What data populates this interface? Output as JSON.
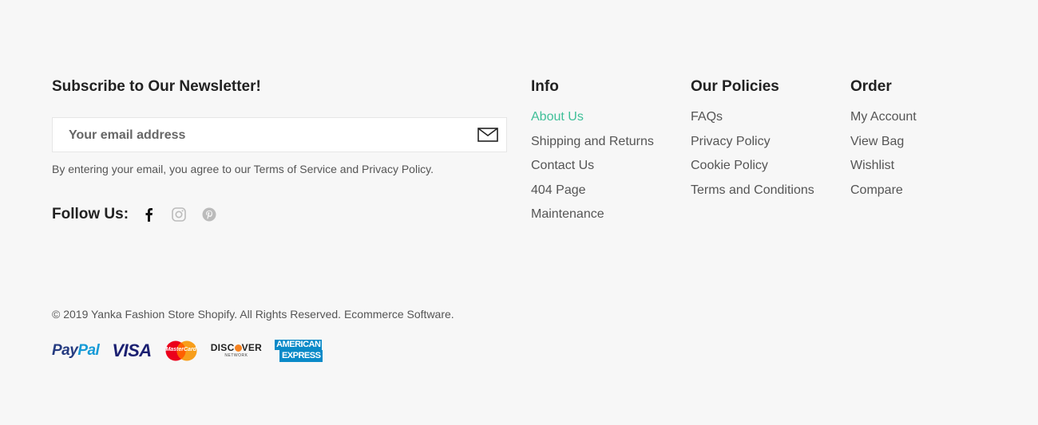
{
  "newsletter": {
    "title": "Subscribe to Our Newsletter!",
    "placeholder": "Your email address",
    "consent": "By entering your email, you agree to our Terms of Service and Privacy Policy."
  },
  "social": {
    "label": "Follow Us:",
    "icons": [
      "facebook-icon",
      "instagram-icon",
      "pinterest-icon"
    ]
  },
  "columns": [
    {
      "title": "Info",
      "links": [
        "About Us",
        "Shipping and Returns",
        "Contact Us",
        "404 Page",
        "Maintenance"
      ]
    },
    {
      "title": "Our Policies",
      "links": [
        "FAQs",
        "Privacy Policy",
        "Cookie Policy",
        "Terms and Conditions"
      ]
    },
    {
      "title": "Order",
      "links": [
        "My Account",
        "View Bag",
        "Wishlist",
        "Compare"
      ]
    }
  ],
  "copyright": "© 2019 Yanka Fashion Store Shopify. All Rights Reserved. Ecommerce Software.",
  "payments": {
    "paypal_a": "Pay",
    "paypal_b": "Pal",
    "visa": "VISA",
    "mastercard": "MasterCard",
    "discover": "DISC",
    "discover_b": "VER",
    "discover_sub": "NETWORK",
    "amex_a": "AMERICAN",
    "amex_b": "EXPRESS"
  },
  "colors": {
    "accent": "#3fbf98",
    "background": "#f7f7f7",
    "heading": "#222222",
    "text": "#555555"
  }
}
